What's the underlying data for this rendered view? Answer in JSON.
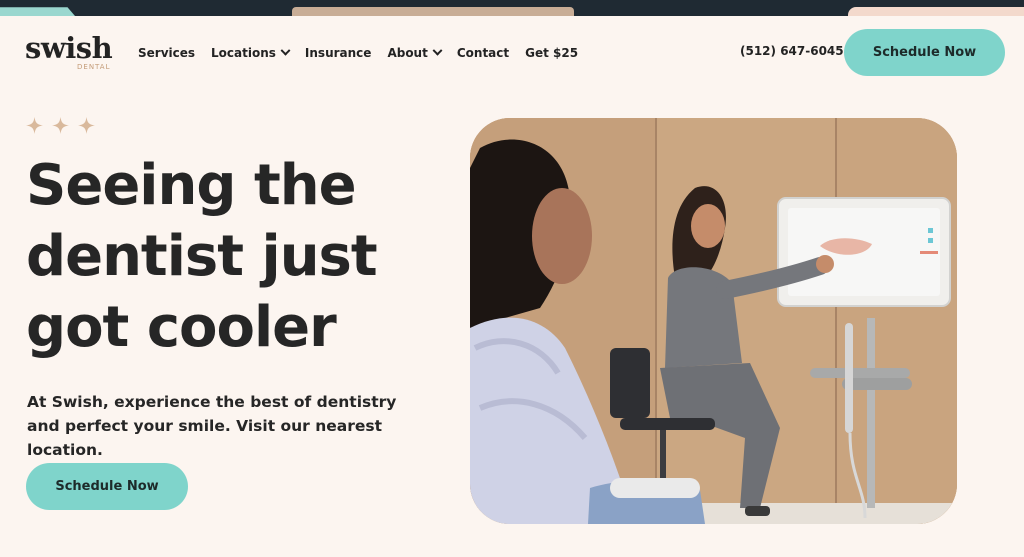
{
  "brand": {
    "name": "swish",
    "sub": "DENTAL",
    "accent": "#7fd4cb",
    "background": "#fcf5f0"
  },
  "nav": {
    "items": [
      {
        "label": "Services",
        "dropdown": false
      },
      {
        "label": "Locations",
        "dropdown": true
      },
      {
        "label": "Insurance",
        "dropdown": false
      },
      {
        "label": "About",
        "dropdown": true
      },
      {
        "label": "Contact",
        "dropdown": false
      },
      {
        "label": "Get $25",
        "dropdown": false
      }
    ],
    "phone": "(512) 647-6045",
    "cta": "Schedule Now"
  },
  "hero": {
    "headline_lines": [
      "Seeing the",
      "dentist just",
      "got cooler"
    ],
    "subtext": "At Swish, experience the best of dentistry and perfect your smile. Visit our nearest location.",
    "cta": "Schedule Now",
    "sparkle_icon": "sparkle-icon",
    "image": "patient-with-dental-assistant-at-scanner-screen"
  }
}
